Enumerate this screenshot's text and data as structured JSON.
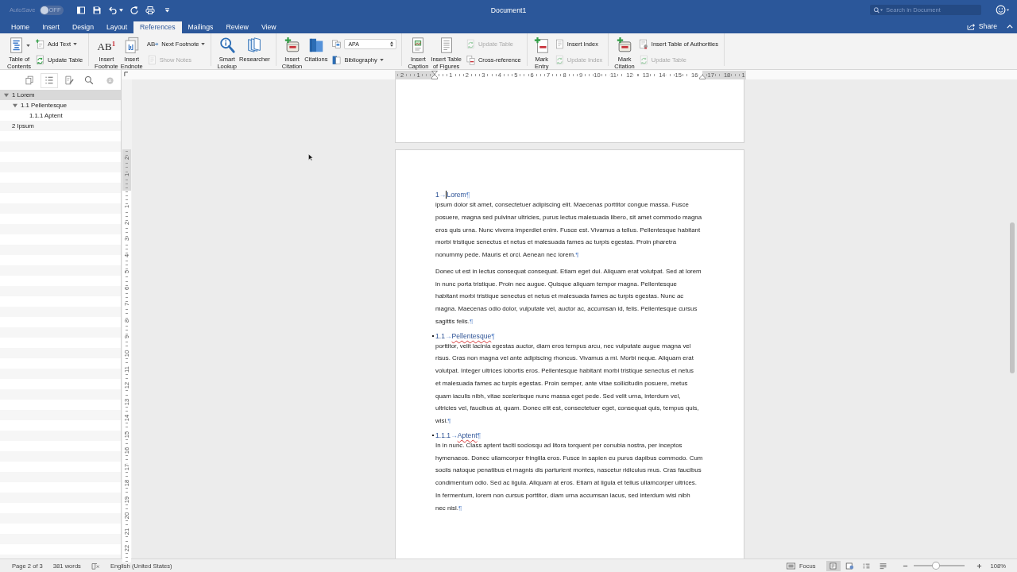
{
  "title_bar": {
    "autosave_label": "AutoSave",
    "autosave_toggle": {
      "label": "OFF",
      "on": false
    },
    "title": "Document1",
    "search": {
      "placeholder": "Search in Document"
    }
  },
  "tabs": [
    {
      "label": "Home",
      "selected": false
    },
    {
      "label": "Insert",
      "selected": false
    },
    {
      "label": "Design",
      "selected": false
    },
    {
      "label": "Layout",
      "selected": false
    },
    {
      "label": "References",
      "selected": true
    },
    {
      "label": "Mailings",
      "selected": false
    },
    {
      "label": "Review",
      "selected": false
    },
    {
      "label": "View",
      "selected": false
    }
  ],
  "share": "Share",
  "ribbon_groups": [
    {
      "large": [
        {
          "lines": [
            "Table of",
            "Contents"
          ],
          "menu": true
        }
      ],
      "small": [
        {
          "kind": "button",
          "label": "Add Text",
          "menu": true,
          "disabled": false
        },
        {
          "kind": "button",
          "label": "Update Table",
          "menu": false,
          "disabled": false
        }
      ]
    },
    {
      "large": [
        {
          "lines": [
            "Insert",
            "Footnote"
          ],
          "glyph": "AB$^{1}$",
          "menu": false
        },
        {
          "lines": [
            "Insert",
            "Endnote"
          ],
          "menu": false
        }
      ],
      "small": [
        {
          "kind": "button",
          "label": "Next Footnote",
          "glyph": "AB",
          "menu": true,
          "disabled": false
        },
        {
          "kind": "button",
          "label": "Show Notes",
          "menu": false,
          "disabled": true
        }
      ]
    },
    {
      "large": [
        {
          "lines": [
            "Smart",
            "Lookup"
          ],
          "menu": false
        },
        {
          "lines": [
            "Researcher"
          ],
          "menu": false
        }
      ]
    },
    {
      "large": [
        {
          "lines": [
            "Insert",
            "Citation"
          ],
          "menu": false
        },
        {
          "lines": [
            "Citations"
          ],
          "menu": false
        }
      ],
      "small": [
        {
          "kind": "select",
          "value": "APA"
        },
        {
          "kind": "button",
          "label": "Bibliography",
          "menu": true,
          "disabled": false
        }
      ]
    },
    {
      "large": [
        {
          "lines": [
            "Insert",
            "Caption"
          ],
          "menu": false
        },
        {
          "lines": [
            "Insert Table",
            "of Figures"
          ],
          "menu": false
        }
      ],
      "small": [
        {
          "kind": "button",
          "label": "Update Table",
          "menu": false,
          "disabled": true
        },
        {
          "kind": "button",
          "label": "Cross-reference",
          "menu": false,
          "disabled": false
        }
      ]
    },
    {
      "large": [
        {
          "lines": [
            "Mark",
            "Entry"
          ],
          "menu": false
        }
      ],
      "small": [
        {
          "kind": "button",
          "label": "Insert Index",
          "menu": false,
          "disabled": false
        },
        {
          "kind": "button",
          "label": "Update Index",
          "menu": false,
          "disabled": true
        }
      ]
    },
    {
      "large": [
        {
          "lines": [
            "Mark",
            "Citation"
          ],
          "menu": false
        }
      ],
      "small": [
        {
          "kind": "button",
          "label": "Insert Table of Authorities",
          "menu": false,
          "disabled": false
        },
        {
          "kind": "button",
          "label": "Update Table",
          "menu": false,
          "disabled": true
        }
      ]
    }
  ],
  "ruler": {
    "left_labels": [
      "2",
      "1"
    ],
    "labels": [
      "1",
      "2",
      "3",
      "4",
      "5",
      "6",
      "7",
      "8",
      "9",
      "10",
      "11",
      "12",
      "13",
      "14",
      "15",
      "16",
      "17",
      "18",
      "1"
    ]
  },
  "vertical_ruler": {
    "top_labels": [
      "2",
      "1"
    ],
    "labels": [
      "1",
      "2",
      "3",
      "4",
      "5",
      "6",
      "7",
      "8",
      "9",
      "10",
      "11",
      "12",
      "13",
      "14",
      "15",
      "16",
      "17",
      "18",
      "19",
      "20",
      "21",
      "22"
    ]
  },
  "navigation_pane": {
    "views": [
      {
        "selected": false
      },
      {
        "selected": true
      },
      {
        "selected": false
      },
      {
        "selected": false
      }
    ],
    "outline": [
      {
        "label": "1 Lorem",
        "selected": true,
        "expanded": true,
        "children": [
          {
            "label": "1.1 Pellentesque",
            "selected": false,
            "expanded": true,
            "children": [
              {
                "label": "1.1.1 Aptent",
                "selected": false
              }
            ]
          }
        ]
      },
      {
        "label": "2 Ipsum",
        "selected": false
      }
    ]
  },
  "document": {
    "blocks": [
      {
        "kind": "heading",
        "number": "1",
        "tab_mark": "→",
        "title": "Lorem",
        "end_mark": "¶",
        "cursor": true,
        "misspelled": false,
        "keep_with_next": false
      },
      {
        "kind": "paragraph",
        "lines": [
          "ipsum dolor sit amet, consectetuer adipiscing elit. Maecenas porttitor congue massa. Fusce",
          "posuere, magna sed pulvinar ultricies, purus lectus malesuada libero, sit amet commodo magna",
          "eros quis urna. Nunc viverra imperdiet enim. Fusce est. Vivamus a tellus. Pellentesque habitant",
          "morbi tristique senectus et netus et malesuada fames ac turpis egestas. Proin pharetra",
          "nonummy pede. Mauris et orci. Aenean nec lorem."
        ],
        "end_mark": "¶"
      },
      {
        "kind": "paragraph",
        "lines": [
          "Donec ut est in lectus consequat consequat. Etiam eget dui. Aliquam erat volutpat. Sed at lorem",
          "in nunc porta tristique. Proin nec augue. Quisque aliquam tempor magna. Pellentesque",
          "habitant morbi tristique senectus et netus et malesuada fames ac turpis egestas. Nunc ac",
          "magna. Maecenas odio dolor, vulputate vel, auctor ac, accumsan id, felis. Pellentesque cursus",
          "sagittis felis."
        ],
        "end_mark": "¶"
      },
      {
        "kind": "heading",
        "number": "1.1",
        "tab_mark": "→",
        "title": "Pellentesque",
        "end_mark": "¶",
        "cursor": false,
        "misspelled": true,
        "keep_with_next": true
      },
      {
        "kind": "paragraph",
        "lines": [
          "porttitor, velit lacinia egestas auctor, diam eros tempus arcu, nec vulputate augue magna vel",
          "risus. Cras non magna vel ante adipiscing rhoncus. Vivamus a mi. Morbi neque. Aliquam erat",
          "volutpat. Integer ultrices lobortis eros. Pellentesque habitant morbi tristique senectus et netus",
          "et malesuada fames ac turpis egestas. Proin semper, ante vitae sollicitudin posuere, metus",
          "quam iaculis nibh, vitae scelerisque nunc massa eget pede. Sed velit urna, interdum vel,",
          "ultricies vel, faucibus at, quam. Donec elit est, consectetuer eget, consequat quis, tempus quis,",
          "wisi."
        ],
        "end_mark": "¶"
      },
      {
        "kind": "heading",
        "number": "1.1.1",
        "tab_mark": "→",
        "title": "Aptent",
        "end_mark": "¶",
        "cursor": false,
        "misspelled": true,
        "keep_with_next": true
      },
      {
        "kind": "paragraph",
        "lines": [
          "In in nunc. Class aptent taciti sociosqu ad litora torquent per conubia nostra, per inceptos",
          "hymenaeos. Donec ullamcorper fringilla eros. Fusce in sapien eu purus dapibus commodo. Cum",
          "sociis natoque penatibus et magnis dis parturient montes, nascetur ridiculus mus. Cras faucibus",
          "condimentum odio. Sed ac ligula. Aliquam at eros. Etiam at ligula et tellus ullamcorper ultrices.",
          "In fermentum, lorem non cursus porttitor, diam urna accumsan lacus, sed interdum wisi nibh",
          "nec nisl."
        ],
        "end_mark": "¶"
      }
    ]
  },
  "status_bar": {
    "page": "Page 2 of 3",
    "words": "381 words",
    "language": "English (United States)",
    "focus": "Focus",
    "views": [
      {
        "selected": true
      },
      {
        "selected": false
      },
      {
        "selected": false
      },
      {
        "selected": false
      }
    ],
    "zoom": {
      "level": 0.45,
      "reading": "108%"
    }
  }
}
